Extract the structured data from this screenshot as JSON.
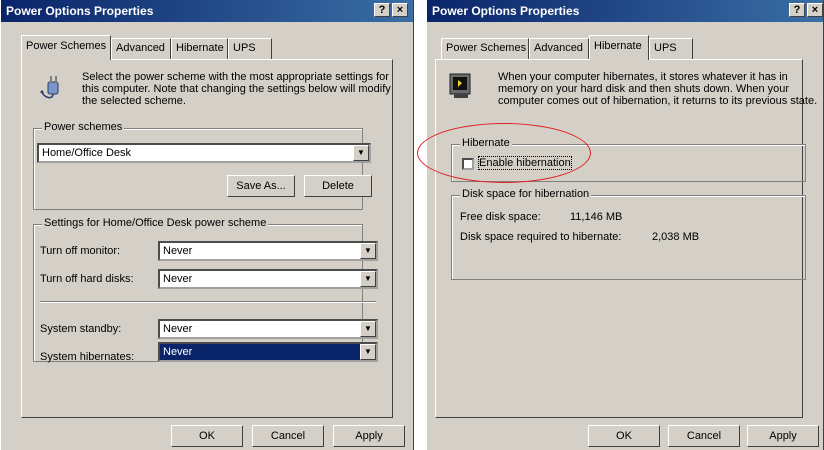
{
  "left_dialog": {
    "title": "Power Options Properties",
    "help_btn": "?",
    "close_btn": "×",
    "tabs": [
      "Power Schemes",
      "Advanced",
      "Hibernate",
      "UPS"
    ],
    "active_tab": "Power Schemes",
    "description": "Select the power scheme with the most appropriate settings for this computer. Note that changing the settings below will modify the selected scheme.",
    "power_schemes": {
      "legend": "Power schemes",
      "selected": "Home/Office Desk",
      "save_as": "Save As...",
      "delete": "Delete"
    },
    "settings": {
      "legend": "Settings for Home/Office Desk power scheme",
      "monitor_label": "Turn off monitor:",
      "monitor_value": "Never",
      "disks_label": "Turn off hard disks:",
      "disks_value": "Never",
      "standby_label": "System standby:",
      "standby_value": "Never",
      "hibernates_label": "System hibernates:",
      "hibernates_value": "Never"
    },
    "buttons": {
      "ok": "OK",
      "cancel": "Cancel",
      "apply": "Apply"
    }
  },
  "right_dialog": {
    "title": "Power Options Properties",
    "help_btn": "?",
    "close_btn": "×",
    "tabs": [
      "Power Schemes",
      "Advanced",
      "Hibernate",
      "UPS"
    ],
    "active_tab": "Hibernate",
    "description": "When your computer hibernates, it stores whatever it has in memory on your hard disk and then shuts down. When your computer comes out of hibernation, it returns to its previous state.",
    "hibernate_group": {
      "legend": "Hibernate",
      "enable_label": "Enable hibernation",
      "enable_checked": false
    },
    "disk_space": {
      "legend": "Disk space for hibernation",
      "free_label": "Free disk space:",
      "free_value": "11,146 MB",
      "required_label": "Disk space required to hibernate:",
      "required_value": "2,038 MB"
    },
    "buttons": {
      "ok": "OK",
      "cancel": "Cancel",
      "apply": "Apply"
    }
  },
  "annotation_color": "#e02020"
}
